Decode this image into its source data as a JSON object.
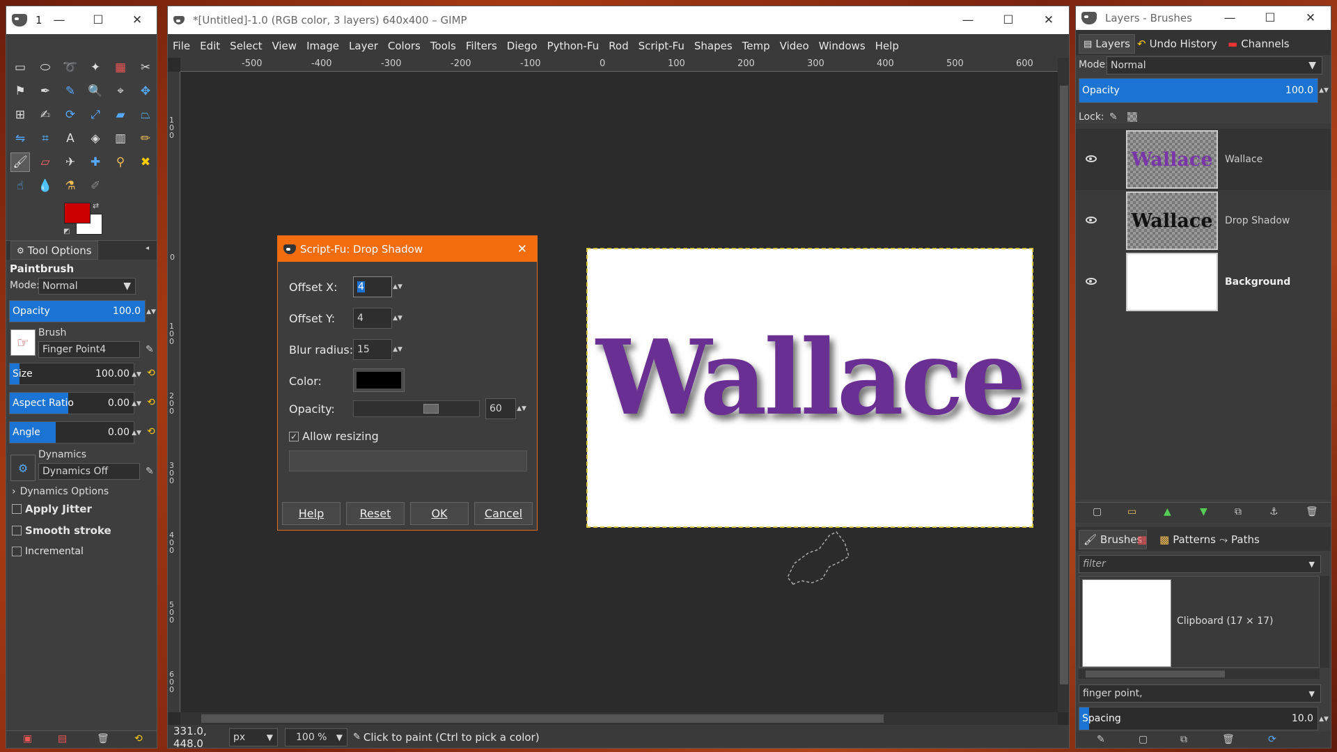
{
  "toolbox": {
    "title": "1",
    "tool_options_tab": "Tool Options",
    "tool_name": "Paintbrush",
    "mode_label": "Mode:",
    "mode_value": "Normal",
    "opacity_label": "Opacity",
    "opacity_value": "100.0",
    "brush_label": "Brush",
    "brush_value": "Finger Point4",
    "size_label": "Size",
    "size_value": "100.00",
    "aspect_label": "Aspect Ratio",
    "aspect_value": "0.00",
    "angle_label": "Angle",
    "angle_value": "0.00",
    "dynamics_label": "Dynamics",
    "dynamics_value": "Dynamics Off",
    "dynamics_options": "Dynamics Options",
    "apply_jitter": "Apply Jitter",
    "smooth_stroke": "Smooth stroke",
    "incremental": "Incremental",
    "fg_color": "#cc0000",
    "bg_color": "#ffffff"
  },
  "main_window": {
    "title": "*[Untitled]-1.0 (RGB color, 3 layers) 640x400 – GIMP",
    "menu": [
      "File",
      "Edit",
      "Select",
      "View",
      "Image",
      "Layer",
      "Colors",
      "Tools",
      "Filters",
      "Diego",
      "Python-Fu",
      "Rod",
      "Script-Fu",
      "Shapes",
      "Temp",
      "Video",
      "Windows",
      "Help"
    ],
    "ruler_h_ticks": [
      "-500",
      "-400",
      "-300",
      "-200",
      "-100",
      "0",
      "100",
      "200",
      "300",
      "400",
      "500",
      "600"
    ],
    "ruler_v_ticks": [
      "1 0 0",
      "0",
      "1 0 0",
      "2 0 0",
      "3 0 0",
      "4 0 0",
      "5 0 0",
      "6 0 0"
    ],
    "canvas_text": "Wallace",
    "canvas_text_color": "#6a2f93",
    "status": {
      "coords": "331.0, 448.0",
      "unit": "px",
      "zoom": "100 %",
      "message": "Click to paint (Ctrl to pick a color)"
    }
  },
  "dialog": {
    "title": "Script-Fu: Drop Shadow",
    "offset_x_label": "Offset X:",
    "offset_x_value": "4",
    "offset_y_label": "Offset Y:",
    "offset_y_value": "4",
    "blur_label": "Blur radius:",
    "blur_value": "15",
    "color_label": "Color:",
    "color_value": "#000000",
    "opacity_label": "Opacity:",
    "opacity_value": "60",
    "allow_resizing": "Allow resizing",
    "buttons": {
      "help": "Help",
      "reset": "Reset",
      "ok": "OK",
      "cancel": "Cancel"
    }
  },
  "layers_window": {
    "title": "Layers - Brushes",
    "tabs": [
      "Layers",
      "Undo History",
      "Channels"
    ],
    "mode_label": "Mode:",
    "mode_value": "Normal",
    "opacity_label": "Opacity",
    "opacity_value": "100.0",
    "lock_label": "Lock:",
    "layers": [
      {
        "name": "Wallace",
        "thumb_text": "Wallace"
      },
      {
        "name": "Drop Shadow",
        "thumb_text": "Wallace"
      },
      {
        "name": "Background",
        "thumb_text": ""
      }
    ],
    "brush_tabs": [
      "Brushes",
      "Patterns",
      "Paths"
    ],
    "filter_placeholder": "filter",
    "brush_name": "Clipboard (17 × 17)",
    "tag_value": "finger point,",
    "spacing_label": "Spacing",
    "spacing_value": "10.0"
  }
}
